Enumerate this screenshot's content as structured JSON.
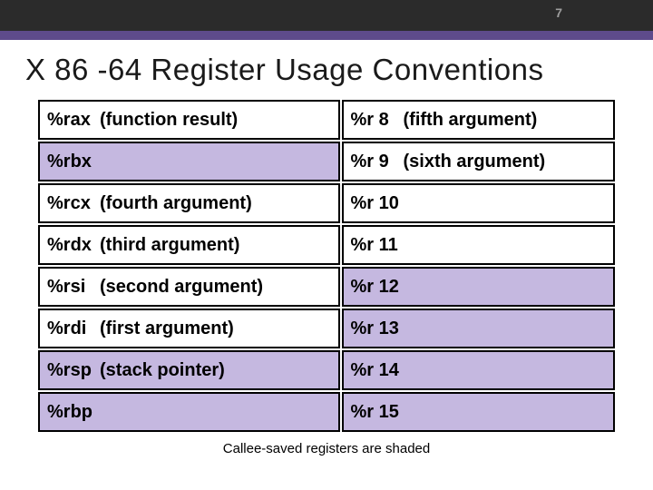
{
  "page_number": "7",
  "title": "X 86 -64 Register Usage Conventions",
  "caption": "Callee-saved registers are shaded",
  "rows": [
    {
      "left": {
        "reg": "%rax",
        "desc": "(function result)",
        "shaded": false
      },
      "right": {
        "reg": "%r 8",
        "desc": "(fifth argument)",
        "shaded": false
      }
    },
    {
      "left": {
        "reg": "%rbx",
        "desc": "",
        "shaded": true
      },
      "right": {
        "reg": "%r 9",
        "desc": "(sixth argument)",
        "shaded": false
      }
    },
    {
      "left": {
        "reg": "%rcx",
        "desc": "(fourth argument)",
        "shaded": false
      },
      "right": {
        "reg": "%r 10",
        "desc": "",
        "shaded": false
      }
    },
    {
      "left": {
        "reg": "%rdx",
        "desc": "(third argument)",
        "shaded": false
      },
      "right": {
        "reg": "%r 11",
        "desc": "",
        "shaded": false
      }
    },
    {
      "left": {
        "reg": "%rsi",
        "desc": "(second argument)",
        "shaded": false
      },
      "right": {
        "reg": "%r 12",
        "desc": "",
        "shaded": true
      }
    },
    {
      "left": {
        "reg": "%rdi",
        "desc": "(first argument)",
        "shaded": false
      },
      "right": {
        "reg": "%r 13",
        "desc": "",
        "shaded": true
      }
    },
    {
      "left": {
        "reg": "%rsp",
        "desc": "(stack pointer)",
        "shaded": true
      },
      "right": {
        "reg": "%r 14",
        "desc": "",
        "shaded": true
      }
    },
    {
      "left": {
        "reg": "%rbp",
        "desc": "",
        "shaded": true
      },
      "right": {
        "reg": "%r 15",
        "desc": "",
        "shaded": true
      }
    }
  ]
}
